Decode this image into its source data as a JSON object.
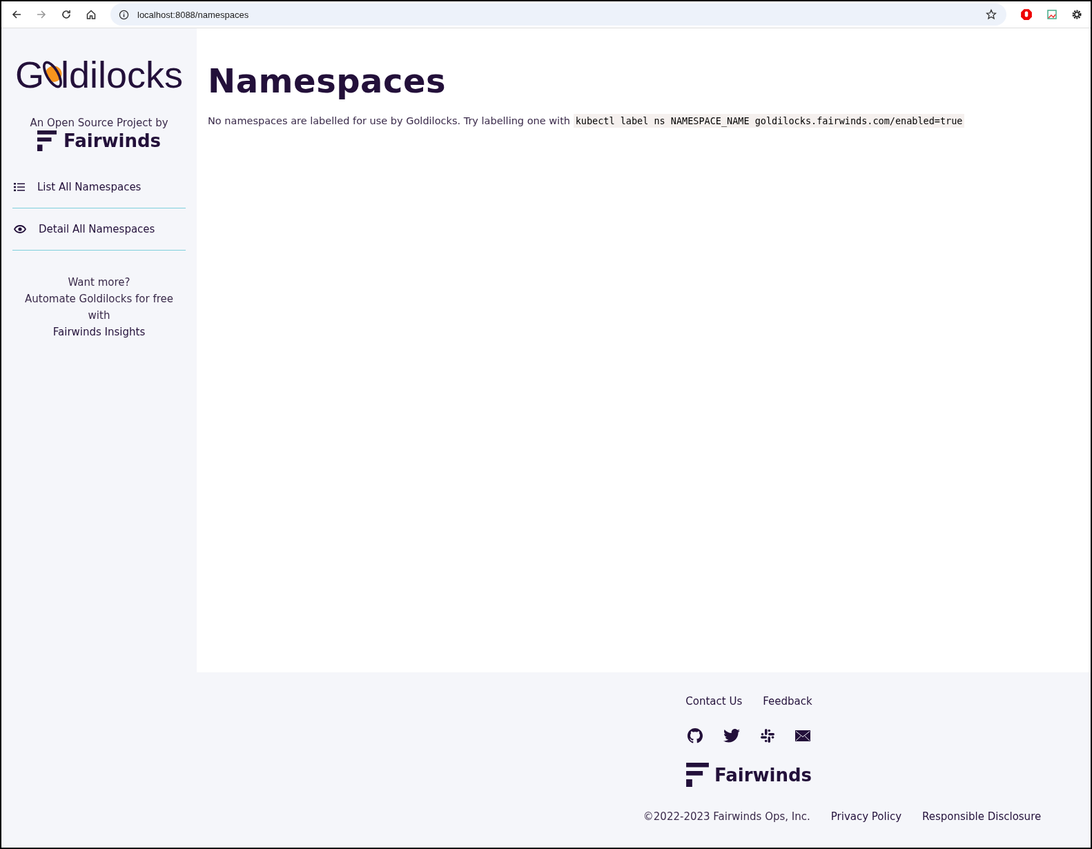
{
  "browser": {
    "url": "localhost:8088/namespaces"
  },
  "sidebar": {
    "logo_before": "G",
    "logo_after": "ldilocks",
    "byline": "An Open Source Project by",
    "brand": "Fairwinds",
    "nav": [
      {
        "kind": "list",
        "label": "List All Namespaces"
      },
      {
        "kind": "eye",
        "label": "Detail All Namespaces"
      }
    ],
    "promo": [
      "Want more?",
      "Automate Goldilocks for free with",
      "Fairwinds Insights"
    ]
  },
  "main": {
    "title": "Namespaces",
    "message": "No namespaces are labelled for use by Goldilocks. Try labelling one with",
    "command": "kubectl label ns NAMESPACE_NAME goldilocks.fairwinds.com/enabled=true"
  },
  "footer": {
    "links": [
      "Contact Us",
      "Feedback"
    ],
    "social": [
      {
        "kind": "github"
      },
      {
        "kind": "twitter"
      },
      {
        "kind": "slack"
      },
      {
        "kind": "mail"
      }
    ],
    "brand": "Fairwinds",
    "copyright": "©2022-2023 Fairwinds Ops, Inc.",
    "legal": [
      "Privacy Policy",
      "Responsible Disclosure"
    ]
  }
}
